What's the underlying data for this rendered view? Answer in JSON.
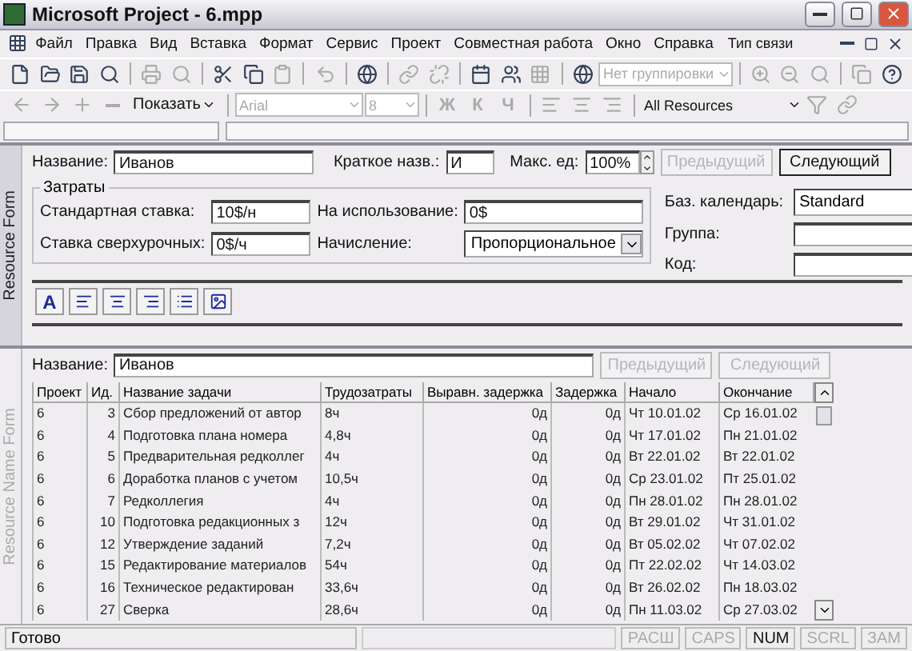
{
  "window": {
    "title": "Microsoft Project - 6.mpp"
  },
  "menu": [
    "Файл",
    "Правка",
    "Вид",
    "Вставка",
    "Формат",
    "Сервис",
    "Проект",
    "Совместная работа",
    "Окно",
    "Справка"
  ],
  "link_type_label": "Тип связи",
  "standard_toolbar": {
    "group_dropdown": {
      "value": "Нет группировки",
      "disabled": true
    }
  },
  "format_toolbar": {
    "show_button": "Показать",
    "font": {
      "value": "Arial",
      "disabled": true
    },
    "size": {
      "value": "8",
      "disabled": true
    },
    "style_buttons": [
      "Ж",
      "К",
      "Ч"
    ],
    "filter": {
      "value": "All Resources"
    }
  },
  "resource_form": {
    "side_label": "Resource Form",
    "name": {
      "label": "Название:",
      "value": "Иванов"
    },
    "initials": {
      "label": "Краткое назв.:",
      "value": "И"
    },
    "max_units": {
      "label": "Макс. ед:",
      "value": "100%"
    },
    "prev_button": {
      "label": "Предыдущий",
      "disabled": true
    },
    "next_button": {
      "label": "Следующий",
      "disabled": false
    },
    "costs": {
      "title": "Затраты",
      "fields": [
        {
          "kind": "text",
          "label": "Стандартная ставка:",
          "value": "10$/н"
        },
        {
          "kind": "text",
          "label": "На использование:",
          "value": "0$"
        },
        {
          "kind": "text",
          "label": "Ставка сверхурочных:",
          "value": "0$/ч"
        },
        {
          "kind": "dropdown",
          "label": "Начисление:",
          "value": "Пропорциональное"
        }
      ]
    },
    "right_fields": [
      {
        "kind": "dropdown",
        "label": "Баз. календарь:",
        "value": "Standard"
      },
      {
        "kind": "text",
        "label": "Группа:"
      },
      {
        "kind": "text",
        "label": "Код:"
      }
    ],
    "notes_toolbar": {
      "font_button": "A"
    }
  },
  "resource_name_form": {
    "side_label": "Resource Name Form",
    "name": {
      "label": "Название:",
      "value": "Иванов"
    },
    "prev_button": {
      "label": "Предыдущий",
      "disabled": true
    },
    "next_button": {
      "label": "Следующий",
      "disabled": true
    },
    "table": {
      "columns": [
        "Проект",
        "Ид.",
        "Название задачи",
        "Трудозатраты",
        "Выравн. задержка",
        "Задержка",
        "Начало",
        "Окончание"
      ],
      "rows": [
        [
          "6",
          "3",
          "Сбор предложений от автор",
          "8ч",
          "0д",
          "0д",
          "Чт 10.01.02",
          "Ср 16.01.02"
        ],
        [
          "6",
          "4",
          "Подготовка плана номера",
          "4,8ч",
          "0д",
          "0д",
          "Чт 17.01.02",
          "Пн 21.01.02"
        ],
        [
          "6",
          "5",
          "Предварительная редколлег",
          "4ч",
          "0д",
          "0д",
          "Вт 22.01.02",
          "Вт 22.01.02"
        ],
        [
          "6",
          "6",
          "Доработка планов с учетом",
          "10,5ч",
          "0д",
          "0д",
          "Ср 23.01.02",
          "Пт 25.01.02"
        ],
        [
          "6",
          "7",
          "Редколлегия",
          "4ч",
          "0д",
          "0д",
          "Пн 28.01.02",
          "Пн 28.01.02"
        ],
        [
          "6",
          "10",
          "Подготовка редакционных з",
          "12ч",
          "0д",
          "0д",
          "Вт 29.01.02",
          "Чт 31.01.02"
        ],
        [
          "6",
          "12",
          "Утверждение заданий",
          "7,2ч",
          "0д",
          "0д",
          "Вт 05.02.02",
          "Чт 07.02.02"
        ],
        [
          "6",
          "15",
          "Редактирование материалов",
          "54ч",
          "0д",
          "0д",
          "Пт 22.02.02",
          "Чт 14.03.02"
        ],
        [
          "6",
          "16",
          "Техническое редактирован",
          "33,6ч",
          "0д",
          "0д",
          "Вт 26.02.02",
          "Пн 18.03.02"
        ],
        [
          "6",
          "27",
          "Сверка",
          "28,6ч",
          "0д",
          "0д",
          "Пн 11.03.02",
          "Ср 27.03.02"
        ]
      ]
    }
  },
  "status_bar": {
    "text": "Готово",
    "indicators": [
      {
        "label": "РАСШ",
        "active": false
      },
      {
        "label": "CAPS",
        "active": false
      },
      {
        "label": "NUM",
        "active": true
      },
      {
        "label": "SCRL",
        "active": false
      },
      {
        "label": "ЗАМ",
        "active": false
      }
    ]
  }
}
